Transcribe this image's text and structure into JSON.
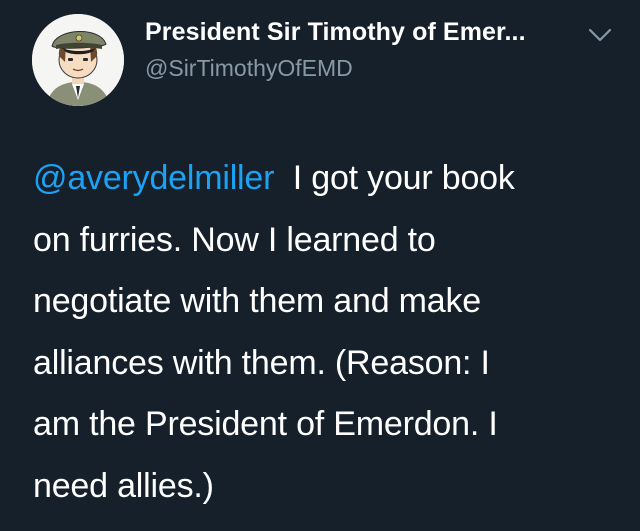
{
  "author": {
    "display_name": "President Sir Timothy of Emer...",
    "handle": "@SirTimothyOfEMD",
    "avatar_icon": "cartoon-officer-avatar"
  },
  "tweet": {
    "mention": "@averydelmiller",
    "text_line1": "I got your book",
    "text_line2": "on furries. Now I learned to",
    "text_line3": "negotiate with them and make",
    "text_line4": "alliances with them. (Reason: I",
    "text_line5": "am the President of Emerdon. I",
    "text_line6": "need allies.)"
  },
  "menu_icon": "chevron-down-icon",
  "colors": {
    "background": "#15202b",
    "text": "#ffffff",
    "secondary": "#8899a6",
    "link": "#1da1f2"
  }
}
